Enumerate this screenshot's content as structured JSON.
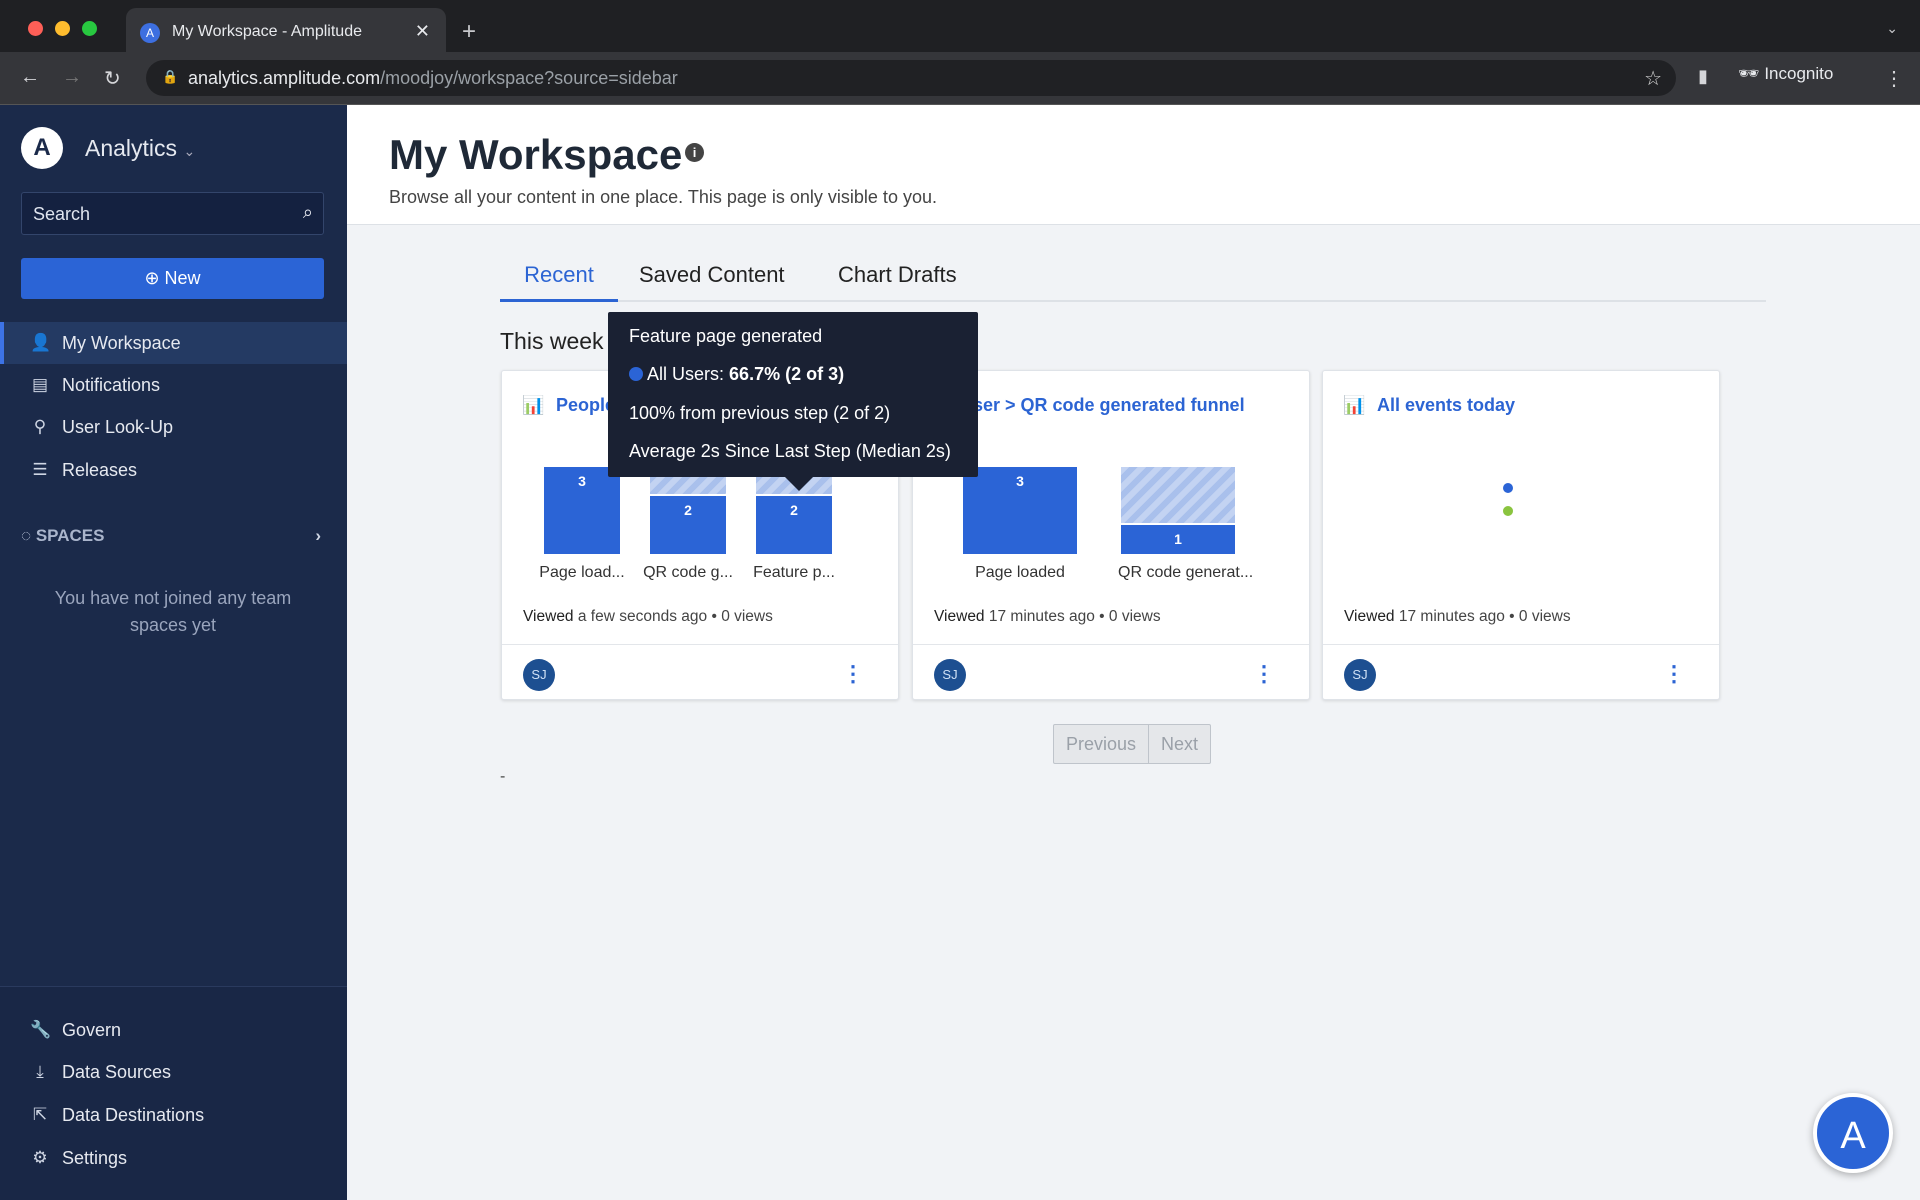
{
  "browser": {
    "tab_title": "My Workspace - Amplitude",
    "url_host": "analytics.amplitude.com",
    "url_path": "/moodjoy/workspace?source=sidebar",
    "profile": "Incognito"
  },
  "sidebar": {
    "app_name": "Analytics",
    "search_placeholder": "Search",
    "new_label": "New",
    "items": [
      {
        "label": "My Workspace",
        "icon": "person-icon"
      },
      {
        "label": "Notifications",
        "icon": "inbox-icon"
      },
      {
        "label": "User Look-Up",
        "icon": "user-lookup-icon"
      },
      {
        "label": "Releases",
        "icon": "releases-icon"
      }
    ],
    "spaces_label": "SPACES",
    "spaces_empty": "You have not joined any team spaces yet",
    "bottom_items": [
      {
        "label": "Govern",
        "icon": "wrench-icon"
      },
      {
        "label": "Data Sources",
        "icon": "download-icon"
      },
      {
        "label": "Data Destinations",
        "icon": "export-icon"
      },
      {
        "label": "Settings",
        "icon": "gear-icon"
      }
    ]
  },
  "header": {
    "title": "My Workspace",
    "subtitle": "Browse all your content in one place. This page is only visible to you."
  },
  "tabs": [
    {
      "label": "Recent",
      "active": true
    },
    {
      "label": "Saved Content"
    },
    {
      "label": "Chart Drafts"
    }
  ],
  "section_title": "This week",
  "cards": [
    {
      "title": "People",
      "viewed_label": "Viewed",
      "viewed": "a few seconds ago",
      "views": "0 views",
      "avatar": "SJ",
      "bars": [
        {
          "label": "Page load...",
          "value": 3
        },
        {
          "label": "QR code g...",
          "value": 2
        },
        {
          "label": "Feature p...",
          "value": 2
        }
      ]
    },
    {
      "title": "ser > QR code generated funnel",
      "viewed_label": "Viewed",
      "viewed": "17 minutes ago",
      "views": "0 views",
      "avatar": "SJ",
      "bars": [
        {
          "label": "Page loaded",
          "value": 3
        },
        {
          "label": "QR code generat...",
          "value": 1
        }
      ]
    },
    {
      "title": "All events today",
      "viewed_label": "Viewed",
      "viewed": "17 minutes ago",
      "views": "0 views",
      "avatar": "SJ",
      "dot_colors": [
        "#2b64d6",
        "#8ac43f"
      ]
    }
  ],
  "tooltip": {
    "title": "Feature page generated",
    "series": "All Users:",
    "value": "66.7% (2 of 3)",
    "line2": "100% from previous step (2 of 2)",
    "line3": "Average 2s Since Last Step (Median 2s)",
    "color": "#2b64d6"
  },
  "pagination": {
    "previous": "Previous",
    "next": "Next"
  },
  "dash": "-",
  "colors": {
    "accent": "#2b64d6",
    "sidebar": "#1b2a4a"
  }
}
